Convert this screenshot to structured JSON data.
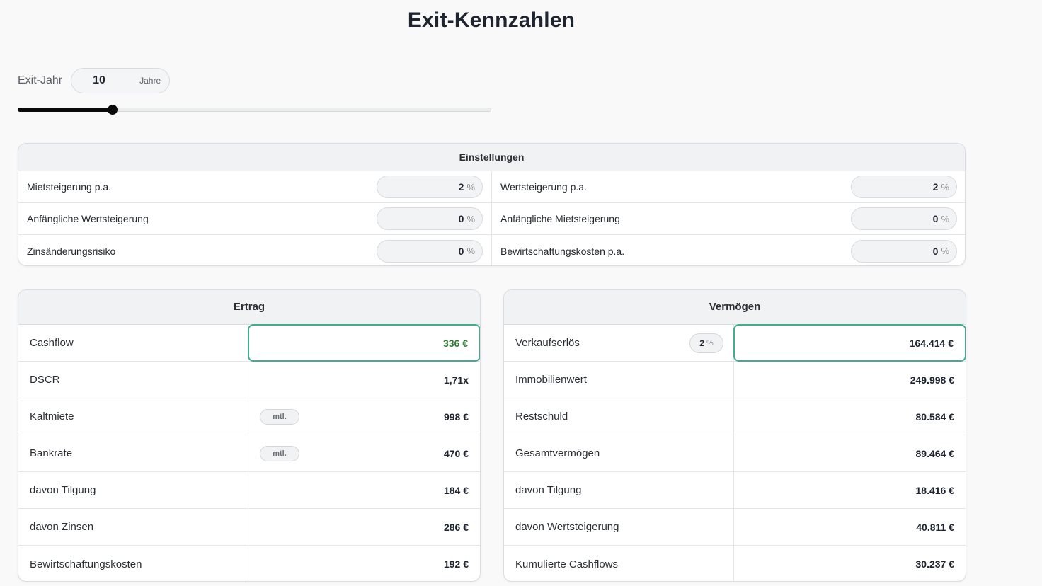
{
  "page": {
    "title": "Exit-Kennzahlen"
  },
  "exit": {
    "label": "Exit-Jahr",
    "value": "10",
    "unit": "Jahre",
    "slider_fraction": 0.2
  },
  "settings": {
    "title": "Einstellungen",
    "rows": [
      {
        "left_label": "Mietsteigerung p.a.",
        "left_value": "2",
        "right_label": "Wertsteigerung p.a.",
        "right_value": "2"
      },
      {
        "left_label": "Anfängliche Wertsteigerung",
        "left_value": "0",
        "right_label": "Anfängliche Mietsteigerung",
        "right_value": "0"
      },
      {
        "left_label": "Zinsänderungsrisiko",
        "left_value": "0",
        "right_label": "Bewirtschaftungskosten p.a.",
        "right_value": "0"
      }
    ],
    "percent_symbol": "%"
  },
  "ertrag": {
    "title": "Ertrag",
    "mtl_label": "mtl.",
    "rows": [
      {
        "label": "Cashflow",
        "value": "336 €"
      },
      {
        "label": "DSCR",
        "value": "1,71x"
      },
      {
        "label": "Kaltmiete",
        "value": "998 €"
      },
      {
        "label": "Bankrate",
        "value": "470 €"
      },
      {
        "label": "davon Tilgung",
        "value": "184 €"
      },
      {
        "label": "davon Zinsen",
        "value": "286 €"
      },
      {
        "label": "Bewirtschaftungskosten",
        "value": "192 €"
      }
    ]
  },
  "vermoegen": {
    "title": "Vermögen",
    "sale_pct": "2",
    "rows": [
      {
        "label": "Verkaufserlös",
        "value": "164.414 €"
      },
      {
        "label": "Immobilienwert",
        "value": "249.998 €"
      },
      {
        "label": "Restschuld",
        "value": "80.584 €"
      },
      {
        "label": "Gesamtvermögen",
        "value": "89.464 €"
      },
      {
        "label": "davon Tilgung",
        "value": "18.416 €"
      },
      {
        "label": "davon Wertsteigerung",
        "value": "40.811 €"
      },
      {
        "label": "Kumulierte Cashflows",
        "value": "30.237 €"
      }
    ]
  },
  "colors": {
    "accent": "#3fae8e",
    "positive": "#2e7d32",
    "slider": "#0b0b0b"
  }
}
